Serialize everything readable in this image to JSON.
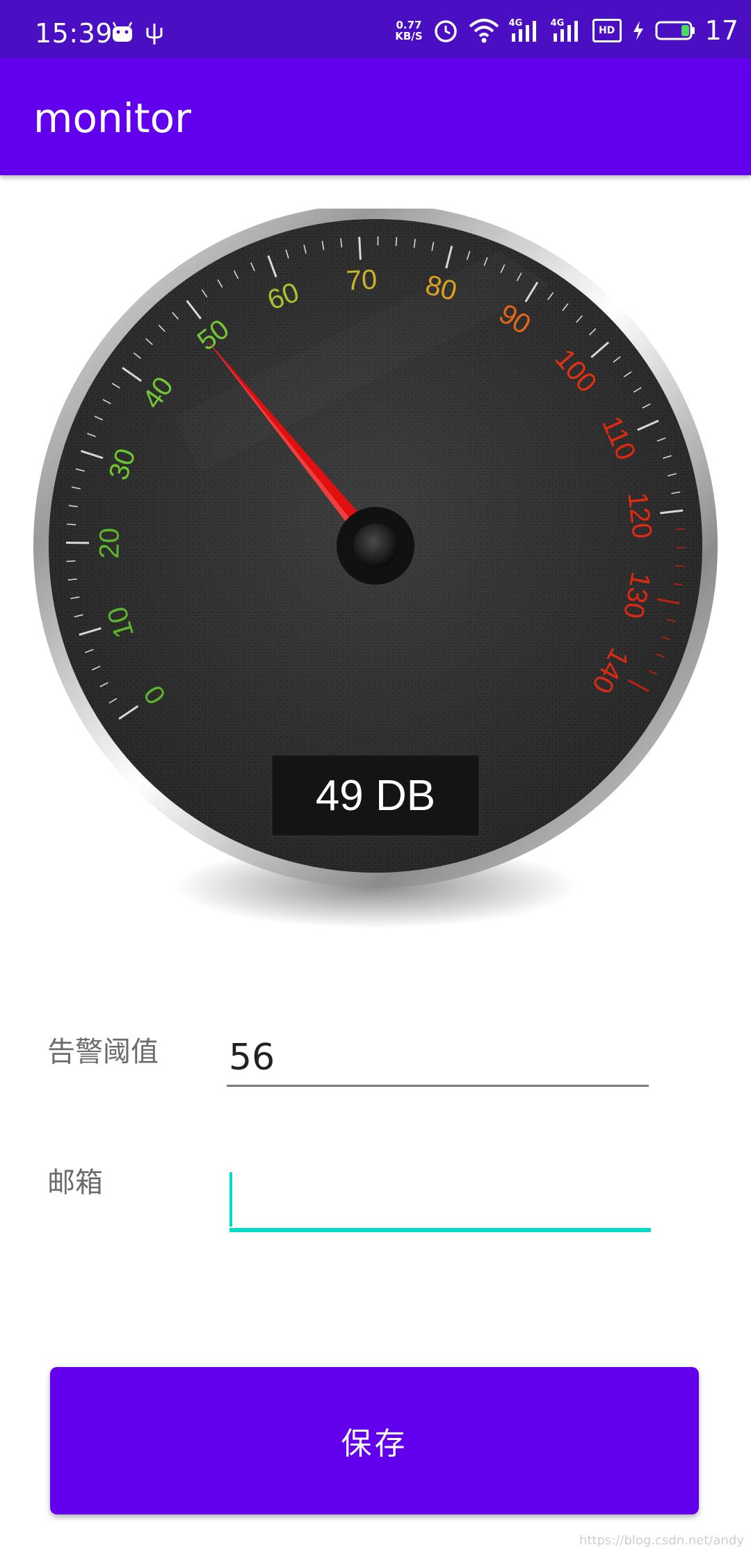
{
  "status_bar": {
    "time": "15:39",
    "net_speed_value": "0.77",
    "net_speed_unit": "KB/S",
    "signal_1_label": "4G",
    "signal_2_label": "4G",
    "hd_label": "HD",
    "battery_percent": "17"
  },
  "app_bar": {
    "title": "monitor"
  },
  "gauge": {
    "value": 49,
    "readout": "49 DB",
    "min": 0,
    "max": 140,
    "tick_labels": [
      "0",
      "10",
      "20",
      "30",
      "40",
      "50",
      "60",
      "70",
      "80",
      "90",
      "100",
      "110",
      "120",
      "130",
      "140"
    ],
    "label_colors": [
      "#5db52b",
      "#5db52b",
      "#5db52b",
      "#6cc62e",
      "#74c736",
      "#74c736",
      "#a6c32e",
      "#c8b42a",
      "#d9a31f",
      "#e1661a",
      "#e2320f",
      "#e02a10",
      "#dd2a10",
      "#dc2a12",
      "#dc2a12"
    ],
    "needle_color": "#e01010"
  },
  "form": {
    "threshold_label": "告警阈值",
    "threshold_value": "56",
    "email_label": "邮箱",
    "email_value": ""
  },
  "save_button": {
    "label": "保存"
  },
  "watermark": "https://blog.csdn.net/andy"
}
